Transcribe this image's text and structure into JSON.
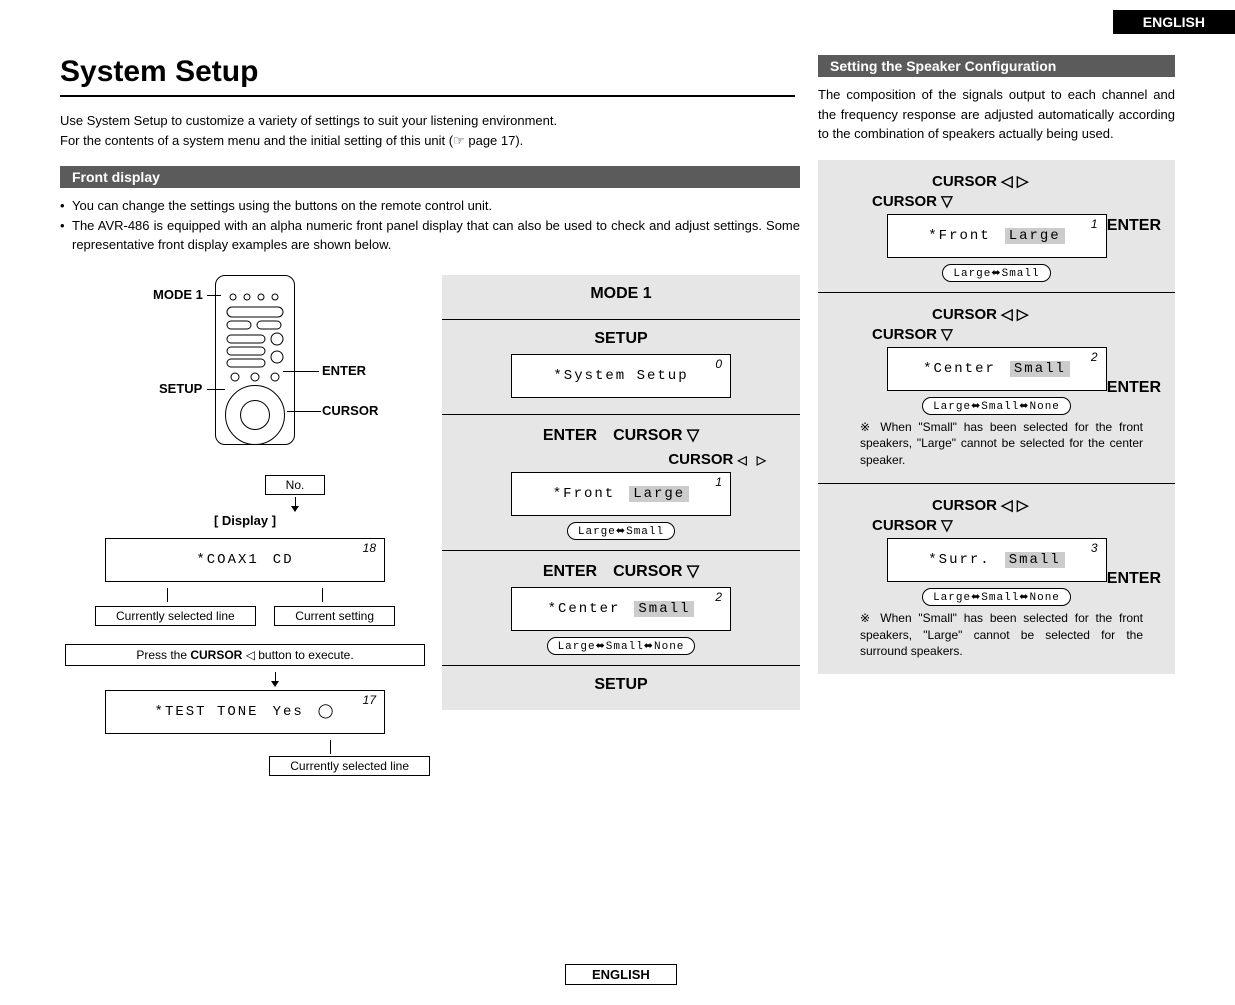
{
  "lang_tab": "ENGLISH",
  "title": "System Setup",
  "intro1": "Use System Setup to customize a variety of settings to suit your listening environment.",
  "intro2_a": "For the contents of a system menu and the initial setting of this unit (",
  "intro2_b": " page 17).",
  "section_front": "Front display",
  "bullet1": "You can change the settings using the buttons on the remote control unit.",
  "bullet2": "The AVR-486 is equipped with an alpha numeric front panel display that can also be used to check and adjust settings. Some representative front display examples are shown below.",
  "remote": {
    "mode1": "MODE 1",
    "enter": "ENTER",
    "setup": "SETUP",
    "cursor": "CURSOR"
  },
  "disp": {
    "no_label": "No.",
    "display_label": "[ Display ]",
    "lcd_no": "18",
    "lcd_left": "*COAX1",
    "lcd_right": "CD",
    "curr_line": "Currently selected line",
    "curr_set": "Current setting",
    "exec_a": "Press the ",
    "exec_b": "CURSOR",
    "exec_c": " ◁ button to execute.",
    "lcd2_no": "17",
    "lcd2_left": "*TEST TONE",
    "lcd2_right": "Yes",
    "curr_line2": "Currently selected line"
  },
  "steps": {
    "s1": "MODE 1",
    "s2": "SETUP",
    "s2_no": "0",
    "s2_text": "*System Setup",
    "s3a": "ENTER",
    "s3b": "CURSOR ▽",
    "s3c": "CURSOR",
    "s3_no": "1",
    "s3_l": "*Front",
    "s3_r": "Large",
    "s3_chip": "Large⬌Small",
    "s4a": "ENTER",
    "s4b": "CURSOR ▽",
    "s4_no": "2",
    "s4_l": "*Center",
    "s4_r": "Small",
    "s4_chip": "Large⬌Small⬌None",
    "s5": "SETUP"
  },
  "section_speaker": "Setting the Speaker Configuration",
  "speaker_intro": "The composition of the signals output to each channel and the frequency response are adjusted automatically according to the combination of speakers actually being used.",
  "rs": {
    "cur_lr": "CURSOR ◁   ▷",
    "cur_d": "CURSOR ▽",
    "enter": "ENTER",
    "r1_no": "1",
    "r1_l": "*Front",
    "r1_r": "Large",
    "r1_chip": "Large⬌Small",
    "r2_no": "2",
    "r2_l": "*Center",
    "r2_r": "Small",
    "r2_chip": "Large⬌Small⬌None",
    "note2a": "When \"Small\" has been selected for the front speakers, \"Large\" cannot be selected for the center speaker.",
    "r3_no": "3",
    "r3_l": "*Surr.",
    "r3_r": "Small",
    "r3_chip": "Large⬌Small⬌None",
    "note3a": "When \"Small\" has been selected for the front speakers, \"Large\" cannot be selected for the surround speakers."
  },
  "footer": "ENGLISH"
}
